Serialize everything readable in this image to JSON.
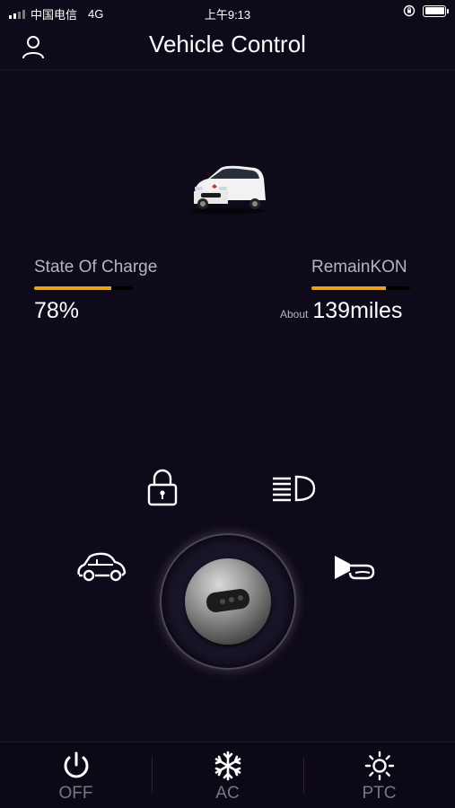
{
  "status_bar": {
    "carrier": "中国电信",
    "network": "4G",
    "time": "上午9:13"
  },
  "header": {
    "title": "Vehicle Control",
    "user_icon": "user-icon"
  },
  "vehicle": {
    "image": "white-car-illustration"
  },
  "charge": {
    "label": "State Of Charge",
    "value": "78%",
    "level": 0.78
  },
  "range": {
    "label": "RemainKON",
    "prefix": "About",
    "value": "139miles",
    "level": 0.75
  },
  "controls": {
    "lock": "lock-icon",
    "headlight": "headlight-icon",
    "car_locate": "car-icon",
    "horn": "horn-icon",
    "key": "car-key-icon"
  },
  "bottom_bar": {
    "items": [
      {
        "label": "OFF",
        "icon": "power-icon"
      },
      {
        "label": "AC",
        "icon": "snowflake-icon"
      },
      {
        "label": "PTC",
        "icon": "sun-icon"
      }
    ]
  },
  "colors": {
    "background": "#0f0a1a",
    "accent": "#e7a423",
    "muted_text": "#b8b4be"
  }
}
